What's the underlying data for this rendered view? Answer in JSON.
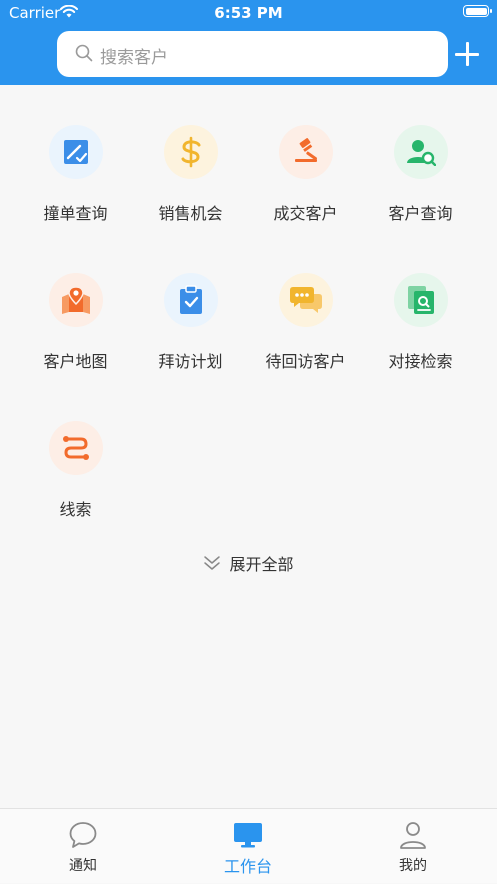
{
  "status_bar": {
    "carrier": "Carrier",
    "time": "6:53 PM"
  },
  "search": {
    "placeholder": "搜索客户"
  },
  "grid": [
    {
      "label": "撞单查询",
      "icon": "collision-check-icon",
      "color": "#3b8ee8",
      "bg": "#eaf4fd"
    },
    {
      "label": "销售机会",
      "icon": "dollar-icon",
      "color": "#f1b52e",
      "bg": "#fdf3de"
    },
    {
      "label": "成交客户",
      "icon": "gavel-icon",
      "color": "#f26b2c",
      "bg": "#fdeee6"
    },
    {
      "label": "客户查询",
      "icon": "user-search-icon",
      "color": "#27b56b",
      "bg": "#e6f6ec"
    },
    {
      "label": "客户地图",
      "icon": "map-pin-icon",
      "color": "#f26b2c",
      "bg": "#fdeee6"
    },
    {
      "label": "拜访计划",
      "icon": "clipboard-check-icon",
      "color": "#3b8ee8",
      "bg": "#eaf4fd"
    },
    {
      "label": "待回访客户",
      "icon": "chat-bubbles-icon",
      "color": "#f1b52e",
      "bg": "#fdf3de"
    },
    {
      "label": "对接检索",
      "icon": "document-search-icon",
      "color": "#27b56b",
      "bg": "#e6f6ec"
    },
    {
      "label": "线索",
      "icon": "route-icon",
      "color": "#f26b2c",
      "bg": "#fdeee6"
    }
  ],
  "expand": {
    "label": "展开全部"
  },
  "tabs": [
    {
      "label": "通知",
      "icon": "chat-icon",
      "active": false
    },
    {
      "label": "工作台",
      "icon": "monitor-icon",
      "active": true
    },
    {
      "label": "我的",
      "icon": "person-icon",
      "active": false
    }
  ],
  "colors": {
    "primary": "#2a94ee",
    "background": "#f7f7f7"
  }
}
